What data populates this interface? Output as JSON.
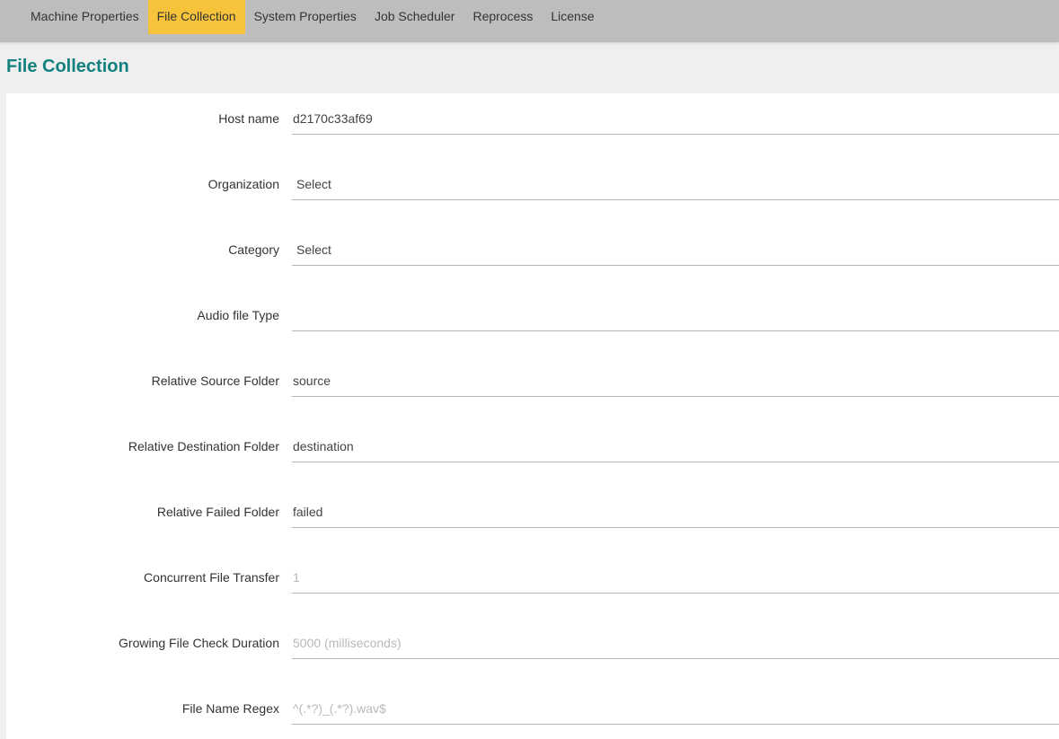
{
  "nav": {
    "tabs": [
      {
        "label": "Machine Properties",
        "active": false
      },
      {
        "label": "File Collection",
        "active": true
      },
      {
        "label": "System Properties",
        "active": false
      },
      {
        "label": "Job Scheduler",
        "active": false
      },
      {
        "label": "Reprocess",
        "active": false
      },
      {
        "label": "License",
        "active": false
      }
    ]
  },
  "page": {
    "title": "File Collection"
  },
  "form": {
    "host_name": {
      "label": "Host name",
      "value": "d2170c33af69"
    },
    "organization": {
      "label": "Organization",
      "value": "Select"
    },
    "category": {
      "label": "Category",
      "value": "Select"
    },
    "audio_file_type": {
      "label": "Audio file Type",
      "value": ""
    },
    "relative_source_folder": {
      "label": "Relative Source Folder",
      "value": "source"
    },
    "relative_destination_folder": {
      "label": "Relative Destination Folder",
      "value": "destination"
    },
    "relative_failed_folder": {
      "label": "Relative Failed Folder",
      "value": "failed"
    },
    "concurrent_file_transfer": {
      "label": "Concurrent File Transfer",
      "value": "",
      "placeholder": "1"
    },
    "growing_file_check_duration": {
      "label": "Growing File Check Duration",
      "value": "",
      "placeholder": "5000 (milliseconds)"
    },
    "file_name_regex": {
      "label": "File Name Regex",
      "value": "",
      "placeholder": "^(.*?)_(.*?).wav$"
    }
  },
  "colors": {
    "accent_active_tab": "#f6c33a",
    "title": "#12807e",
    "topbar": "#bdbdbd",
    "background": "#efefef"
  }
}
